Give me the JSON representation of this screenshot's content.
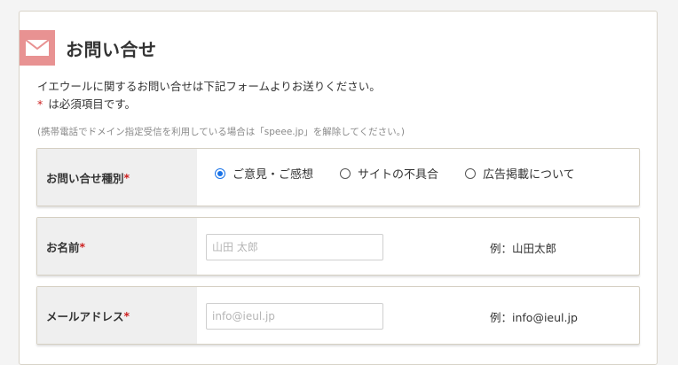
{
  "colors": {
    "accent": "#e89292",
    "required": "#cc1e1e",
    "radio_checked": "#1a73e8",
    "label_bg": "#efefef"
  },
  "header": {
    "icon": "mail-icon",
    "title": "お問い合せ"
  },
  "intro_text": "イエウールに関するお問い合せは下記フォームよりお送りください。",
  "required_note": {
    "star": "*",
    "text": "は必須項目です。"
  },
  "note_text": "(携帯電話でドメイン指定受信を利用している場合は「speee.jp」を解除してください。)",
  "form": {
    "inquiry_type": {
      "label": "お問い合せ種別",
      "star": "*",
      "options": [
        {
          "label": "ご意見・ご感想",
          "checked": true
        },
        {
          "label": "サイトの不具合",
          "checked": false
        },
        {
          "label": "広告掲載について",
          "checked": false
        }
      ]
    },
    "name": {
      "label": "お名前",
      "star": "*",
      "placeholder": "山田 太郎",
      "value": "",
      "example": "例：山田太郎"
    },
    "email": {
      "label": "メールアドレス",
      "star": "*",
      "placeholder": "info@ieul.jp",
      "value": "",
      "example": "例：info@ieul.jp"
    }
  }
}
